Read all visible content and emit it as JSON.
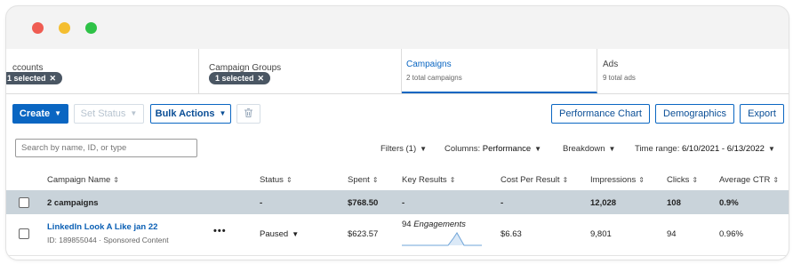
{
  "tabs": [
    {
      "label": "ccounts",
      "chip": "1 selected"
    },
    {
      "label": "Campaign Groups",
      "chip": "1 selected"
    },
    {
      "label": "Campaigns",
      "sub": "2 total campaigns"
    },
    {
      "label": "Ads",
      "sub": "9 total ads"
    }
  ],
  "toolbar": {
    "create": "Create",
    "set_status": "Set Status",
    "bulk_actions": "Bulk Actions",
    "performance_chart": "Performance Chart",
    "demographics": "Demographics",
    "export": "Export"
  },
  "filters": {
    "search_placeholder": "Search by name, ID, or type",
    "filters_label": "Filters (1)",
    "columns_label": "Columns:",
    "columns_value": "Performance",
    "breakdown": "Breakdown",
    "time_range_label": "Time range:",
    "time_range_value": "6/10/2021 - 6/13/2022"
  },
  "table": {
    "headers": [
      "Campaign Name",
      "Status",
      "Spent",
      "Key Results",
      "Cost Per Result",
      "Impressions",
      "Clicks",
      "Average CTR"
    ],
    "summary": {
      "name": "2 campaigns",
      "status": "-",
      "spent": "$768.50",
      "key_results": "-",
      "cost_per_result": "-",
      "impressions": "12,028",
      "clicks": "108",
      "ctr": "0.9%"
    },
    "rows": [
      {
        "name": "LinkedIn Look A Like jan 22",
        "meta": "ID: 189855044 · Sponsored Content",
        "menu": "•••",
        "status": "Paused",
        "spent": "$623.57",
        "key_results_count": "94",
        "key_results_label": "Engagements",
        "cost_per_result": "$6.63",
        "impressions": "9,801",
        "clicks": "94",
        "ctr": "0.96%"
      }
    ]
  },
  "colors": {
    "accent": "#0a66c2",
    "summary_bg": "#c9d3da",
    "chip_bg": "#4a5663"
  },
  "icons": [
    "trash-icon",
    "sort-icon",
    "caret-down-icon",
    "close-icon",
    "sparkline"
  ]
}
